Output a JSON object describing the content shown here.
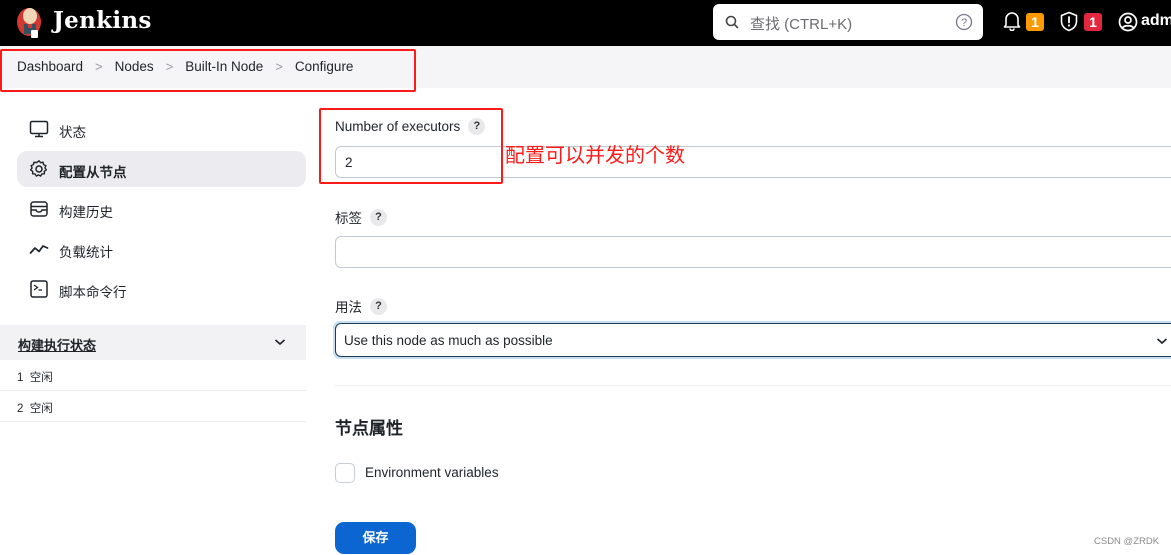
{
  "header": {
    "brand": "Jenkins",
    "search_placeholder": "查找 (CTRL+K)",
    "notifications_count": "1",
    "security_count": "1",
    "user_name": "adm",
    "colors": {
      "background": "#000000",
      "notification_badge": "#fe9a00",
      "security_badge": "#e5263f"
    }
  },
  "breadcrumb": {
    "items": [
      "Dashboard",
      "Nodes",
      "Built-In Node",
      "Configure"
    ]
  },
  "sidebar": {
    "items": [
      {
        "label": "状态",
        "icon": "monitor-icon",
        "active": false
      },
      {
        "label": "配置从节点",
        "icon": "gear-icon",
        "active": true
      },
      {
        "label": "构建历史",
        "icon": "inbox-icon",
        "active": false
      },
      {
        "label": "负载统计",
        "icon": "line-chart-icon",
        "active": false
      },
      {
        "label": "脚本命令行",
        "icon": "terminal-icon",
        "active": false
      }
    ],
    "executor_status": {
      "title": "构建执行状态",
      "rows": [
        {
          "number": "1",
          "status": "空闲"
        },
        {
          "number": "2",
          "status": "空闲"
        }
      ]
    }
  },
  "form": {
    "executors": {
      "label": "Number of executors",
      "value": "2",
      "help": "?"
    },
    "labels": {
      "label": "标签",
      "value": "",
      "help": "?"
    },
    "usage": {
      "label": "用法",
      "value": "Use this node as much as possible",
      "help": "?"
    },
    "node_properties": {
      "title": "节点属性",
      "checkbox_label": "Environment variables",
      "checked": false
    },
    "save_label": "保存",
    "accent_color": "#0b66d1"
  },
  "annotation": {
    "text": "配置可以并发的个数",
    "color": "#ff1a1a"
  },
  "watermark": "CSDN @ZRDK"
}
